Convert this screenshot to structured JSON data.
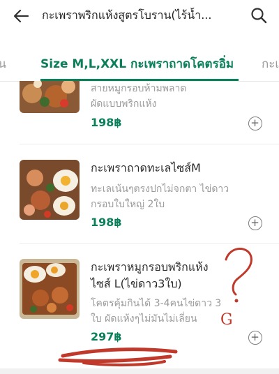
{
  "header": {
    "title": "กะเพราพริกแห้งสูตรโบราน(ไร้น้ำ...",
    "back_icon": "arrow-left-icon",
    "search_icon": "search-icon"
  },
  "tabs": {
    "prev_label": "มัน",
    "active_label": "Size M,L,XXL กะเพราถาดโคตรอิ่ม",
    "next_label": "กะเ"
  },
  "accent_color": "#0a7f5a",
  "items": [
    {
      "name": "",
      "desc_line1": "สายหมูกรอบห้ามพลาด",
      "desc_line2": "ผัดแบบพริกแห้ง",
      "price": "198฿",
      "add_icon": "plus-circle-icon"
    },
    {
      "name": "กะเพราถาดทะเลไซส์M",
      "desc_line1": "ทะเลเน้นๆตรงปกไม่จกตา ไข่ดาว",
      "desc_line2": "กรอบใบใหญ่ 2ใบ",
      "price": "198฿",
      "add_icon": "plus-circle-icon"
    },
    {
      "name_line1": "กะเพราหมูกรอบพริกแห้ง",
      "name_line2": "ไซส์ L(ไข่ดาว3ใบ)",
      "desc_line1": "โคตรคุ้มกินได้ 3-4คนไข่ดาว 3",
      "desc_line2": "ใบ ผัดแห้งๆไม่มันไม่เลี่ยน",
      "price": "297฿",
      "add_icon": "plus-circle-icon"
    }
  ],
  "annotation": {
    "glyph": "G"
  }
}
